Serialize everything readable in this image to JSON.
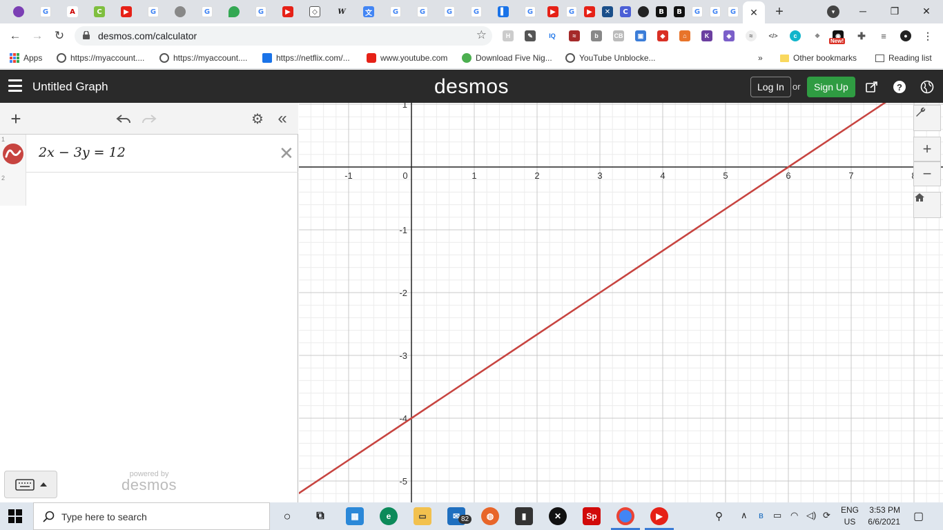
{
  "browser": {
    "url": "desmos.com/calculator",
    "new_badge": "New!",
    "tab_letters": [
      "W",
      "B",
      "B",
      "C",
      "Sp"
    ]
  },
  "bookmarks": {
    "apps": "Apps",
    "items": [
      "https://myaccount....",
      "https://myaccount....",
      "https://netflix.com/...",
      "www.youtube.com",
      "Download Five Nig...",
      "YouTube Unblocke..."
    ],
    "more": "»",
    "other": "Other bookmarks",
    "reading_list": "Reading list"
  },
  "desmos": {
    "graph_title": "Untitled Graph",
    "logo": "desmos",
    "login": "Log In",
    "or": "or",
    "signup": "Sign Up",
    "brand_green": "#2f9c42",
    "header_color": "#2a2a2a"
  },
  "expressions": [
    {
      "num": "1",
      "latex": "2x − 3y = 12",
      "color": "#c74440"
    },
    {
      "num": "2",
      "latex": ""
    }
  ],
  "powered_by": {
    "small": "powered by",
    "logo": "desmos"
  },
  "graph": {
    "x_ticks": [
      "-1",
      "0",
      "1",
      "2",
      "3",
      "4",
      "5",
      "6",
      "7",
      "8"
    ],
    "y_ticks_pos": [
      "1"
    ],
    "y_ticks_neg": [
      "-1",
      "-2",
      "-3",
      "-4",
      "-5"
    ],
    "line_color": "#c74440",
    "equation": {
      "a": 2,
      "b": -3,
      "c": 12
    }
  },
  "taskbar": {
    "search_placeholder": "Type here to search",
    "mail_badge": "82",
    "lang_top": "ENG",
    "lang_bottom": "US",
    "time": "3:53 PM",
    "date": "6/6/2021"
  }
}
